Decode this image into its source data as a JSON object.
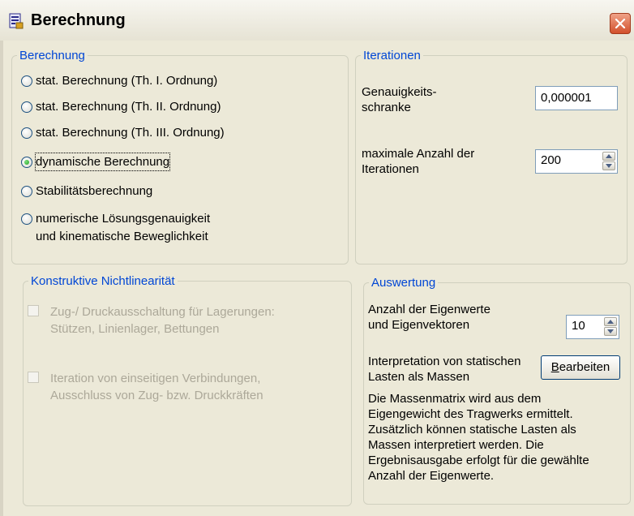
{
  "window": {
    "title": "Berechnung"
  },
  "berechnung_group": {
    "legend": "Berechnung",
    "options": [
      {
        "label": "stat. Berechnung (Th. I. Ordnung)",
        "checked": false
      },
      {
        "label": "stat. Berechnung (Th. II. Ordnung)",
        "checked": false
      },
      {
        "label": "stat. Berechnung (Th. III. Ordnung)",
        "checked": false
      },
      {
        "label": "dynamische Berechnung",
        "checked": true
      },
      {
        "label": "Stabilitätsberechnung",
        "checked": false
      },
      {
        "label": "numerische Lösungsgenauigkeit\nund kinematische Beweglichkeit",
        "checked": false
      }
    ]
  },
  "nichtlinear_group": {
    "legend": "Konstruktive Nichtlinearität",
    "options": [
      {
        "label": "Zug-/ Druckausschaltung für Lagerungen:\nStützen, Linienlager, Bettungen",
        "checked": false,
        "enabled": false
      },
      {
        "label": "Iteration von einseitigen Verbindungen,\nAusschluss von Zug- bzw. Druckkräften",
        "checked": false,
        "enabled": false
      }
    ]
  },
  "iterationen_group": {
    "legend": "Iterationen",
    "genauigkeit_label": "Genauigkeits-\nschranke",
    "genauigkeit_value": "0,000001",
    "max_iter_label": "maximale Anzahl der\nIterationen",
    "max_iter_value": "200"
  },
  "auswertung_group": {
    "legend": "Auswertung",
    "eigenwerte_label": "Anzahl der Eigenwerte\nund Eigenvektoren",
    "eigenwerte_value": "10",
    "interpretation_label": "Interpretation von statischen\nLasten als Massen",
    "bearbeiten_access": "B",
    "bearbeiten_rest": "earbeiten",
    "description": "Die Massenmatrix wird aus dem Eigengewicht des Tragwerks ermittelt. Zusätzlich können statische Lasten als Massen interpretiert werden. Die Ergebnisausgabe erfolgt für die gewählte Anzahl der Eigenwerte."
  },
  "colors": {
    "legend_text": "#0046d5",
    "disabled_text": "#aca899",
    "close_button": "#d2502c",
    "radio_checked": "#21a121"
  },
  "icons": {
    "app": "calculator-document-icon",
    "close": "close-x-icon"
  }
}
